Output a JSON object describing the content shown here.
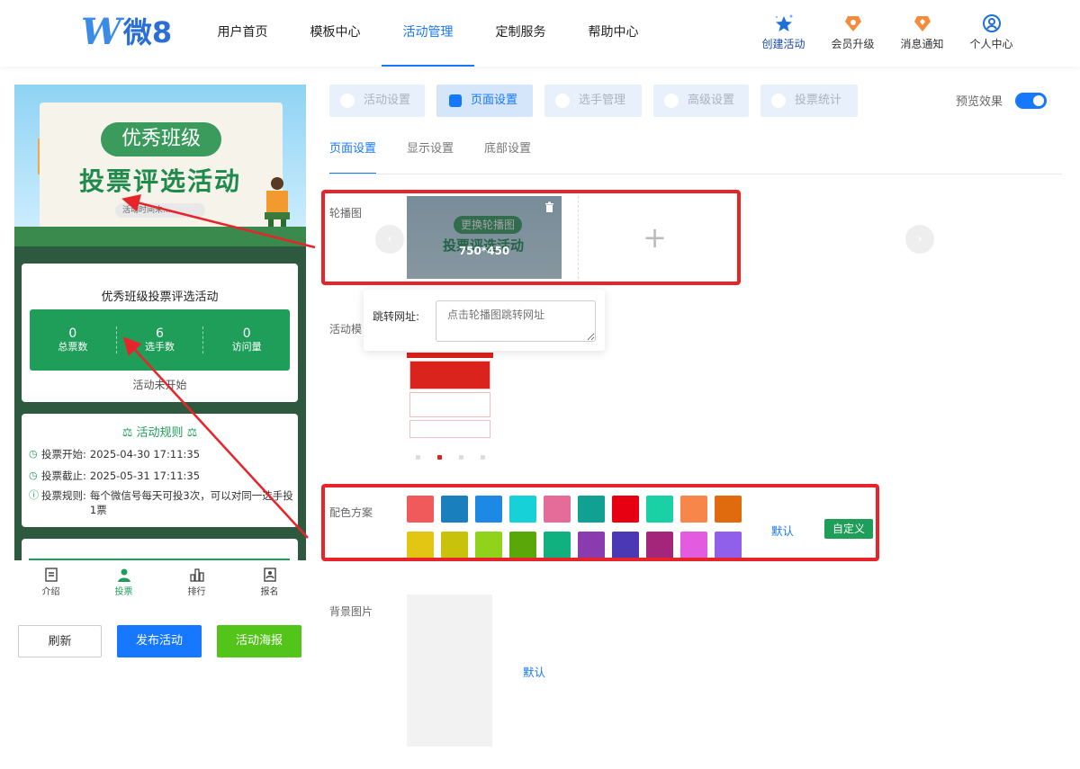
{
  "header": {
    "logo_w": "W",
    "logo_text": "微8",
    "nav": [
      {
        "label": "用户首页"
      },
      {
        "label": "模板中心"
      },
      {
        "label": "活动管理"
      },
      {
        "label": "定制服务"
      },
      {
        "label": "帮助中心"
      }
    ],
    "active_nav": "活动管理",
    "tools": [
      {
        "label": "创建活动",
        "icon": "star-icon"
      },
      {
        "label": "会员升级",
        "icon": "badge-icon"
      },
      {
        "label": "消息通知",
        "icon": "bell-badge-icon"
      },
      {
        "label": "个人中心",
        "icon": "user-circle-icon"
      }
    ]
  },
  "preview": {
    "banner": {
      "pill": "优秀班级",
      "title": "投票评选活动",
      "time_text": "活动时间未..."
    },
    "summary": {
      "title": "优秀班级投票评选活动",
      "stats": [
        {
          "value": "0",
          "label": "总票数"
        },
        {
          "value": "6",
          "label": "选手数"
        },
        {
          "value": "0",
          "label": "访问量"
        }
      ],
      "status": "活动未开始"
    },
    "rules": {
      "heading": "活动规则",
      "rows": [
        {
          "key": "投票开始:",
          "value": "2025-04-30 17:11:35"
        },
        {
          "key": "投票截止:",
          "value": "2025-05-31 17:11:35"
        },
        {
          "key": "投票规则:",
          "value": "每个微信号每天可投3次，可以对同一选手投1票"
        }
      ]
    },
    "tabbar": [
      {
        "label": "介绍"
      },
      {
        "label": "投票"
      },
      {
        "label": "排行"
      },
      {
        "label": "报名"
      }
    ],
    "active_tab": "投票"
  },
  "actions": {
    "refresh": "刷新",
    "publish": "发布活动",
    "poster": "活动海报"
  },
  "settings": {
    "subtabs": [
      {
        "label": "活动设置"
      },
      {
        "label": "页面设置"
      },
      {
        "label": "选手管理"
      },
      {
        "label": "高级设置"
      },
      {
        "label": "投票统计"
      }
    ],
    "active_subtab": "页面设置",
    "preview_toggle_label": "预览效果",
    "preview_toggle_on": true,
    "inner_tabs": [
      {
        "label": "页面设置"
      },
      {
        "label": "显示设置"
      },
      {
        "label": "底部设置"
      }
    ],
    "active_inner_tab": "页面设置",
    "carousel": {
      "label": "轮播图",
      "change_text": "更换轮播图",
      "image_title": "投票评选活动",
      "size_hint": "750*450",
      "add_symbol": "+",
      "prev": "‹",
      "next": "›"
    },
    "jump_url": {
      "label": "跳转网址:",
      "placeholder": "点击轮播图跳转网址"
    },
    "template_label": "活动模",
    "color_scheme": {
      "label": "配色方案",
      "colors": [
        "#f05a5a",
        "#1a7fbd",
        "#1e88e5",
        "#16d1d8",
        "#e56b99",
        "#10a193",
        "#e60012",
        "#1ad1a6",
        "#f7864a",
        "#e06a0e",
        "#e3c514",
        "#c9c20c",
        "#8fd41a",
        "#5aa70a",
        "#10b07f",
        "#8a3bae",
        "#4b38b5",
        "#a3267a",
        "#e35ce0",
        "#9160ea"
      ],
      "default_label": "默认",
      "custom_label": "自定义"
    },
    "background": {
      "label": "背景图片",
      "default_label": "默认"
    }
  }
}
